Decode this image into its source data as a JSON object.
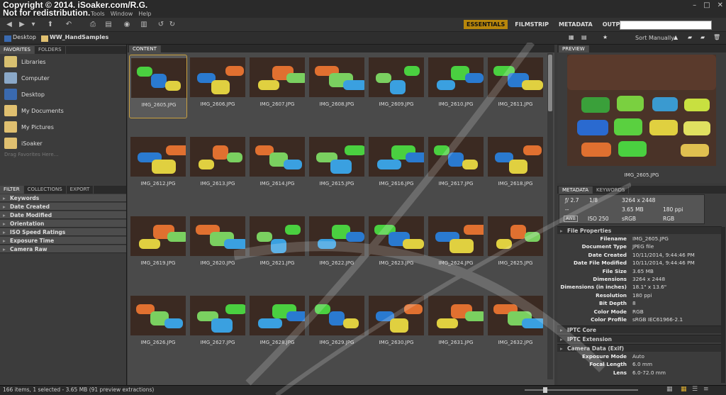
{
  "watermark": {
    "line1": "Copyright © 2014. iSoaker.com/R.G.",
    "line2": "Not for redistribution."
  },
  "menu": [
    "Tools",
    "Window",
    "Help"
  ],
  "window_controls": [
    "–",
    "□",
    "✕"
  ],
  "workspaces": [
    {
      "label": "ESSENTIALS",
      "active": true
    },
    {
      "label": "FILMSTRIP",
      "active": false
    },
    {
      "label": "METADATA",
      "active": false
    },
    {
      "label": "OUTPUT",
      "active": false
    }
  ],
  "search": {
    "value": "",
    "placeholder": ""
  },
  "path": {
    "root": "Desktop",
    "folder": "WW_HandSamples"
  },
  "sort": {
    "label": "Sort Manually"
  },
  "left_tabs": {
    "favorites": "FAVORITES",
    "folders": "FOLDERS"
  },
  "favorites": [
    {
      "label": "Libraries",
      "icon": "libraries-icon",
      "color": "#d8c070"
    },
    {
      "label": "Computer",
      "icon": "computer-icon",
      "color": "#8aa8c8"
    },
    {
      "label": "Desktop",
      "icon": "desktop-icon",
      "color": "#3a6ab0"
    },
    {
      "label": "My Documents",
      "icon": "folder-icon",
      "color": "#e0c070"
    },
    {
      "label": "My Pictures",
      "icon": "folder-icon",
      "color": "#e0c070"
    },
    {
      "label": "iSoaker",
      "icon": "folder-icon",
      "color": "#e0c070"
    }
  ],
  "drag_hint": "Drag Favorites Here...",
  "filter_tabs": {
    "filter": "FILTER",
    "collections": "COLLECTIONS",
    "export": "EXPORT"
  },
  "filters": [
    "Keywords",
    "Date Created",
    "Date Modified",
    "Orientation",
    "ISO Speed Ratings",
    "Exposure Time",
    "Camera Raw"
  ],
  "content_tab": "CONTENT",
  "thumbnails": [
    "IMG_2605.JPG",
    "IMG_2606.JPG",
    "IMG_2607.JPG",
    "IMG_2608.JPG",
    "IMG_2609.JPG",
    "IMG_2610.JPG",
    "IMG_2611.JPG",
    "IMG_2612.JPG",
    "IMG_2613.JPG",
    "IMG_2614.JPG",
    "IMG_2615.JPG",
    "IMG_2616.JPG",
    "IMG_2617.JPG",
    "IMG_2618.JPG",
    "IMG_2619.JPG",
    "IMG_2620.JPG",
    "IMG_2621.JPG",
    "IMG_2622.JPG",
    "IMG_2623.JPG",
    "IMG_2624.JPG",
    "IMG_2625.JPG",
    "IMG_2626.JPG",
    "IMG_2627.JPG",
    "IMG_2628.JPG",
    "IMG_2629.JPG",
    "IMG_2630.JPG",
    "IMG_2631.JPG",
    "IMG_2632.JPG"
  ],
  "selected_index": 0,
  "preview": {
    "tab": "PREVIEW",
    "caption": "IMG_2605.JPG"
  },
  "meta_tabs": {
    "metadata": "METADATA",
    "keywords": "KEYWORDS"
  },
  "exif": {
    "aperture": "ƒ/ 2.7",
    "shutter": "1/8",
    "dimensions": "3264 x 2448",
    "size": "3.65 MB",
    "ppi": "180 ppi",
    "wb": "AWB",
    "iso": "ISO 250",
    "color": "sRGB",
    "mode": "RGB",
    "dash": "--"
  },
  "sections": {
    "file_properties": "File Properties",
    "iptc_core": "IPTC Core",
    "iptc_ext": "IPTC Extension",
    "camera": "Camera Data (Exif)"
  },
  "file_properties": [
    {
      "k": "Filename",
      "v": "IMG_2605.JPG"
    },
    {
      "k": "Document Type",
      "v": "JPEG file"
    },
    {
      "k": "Date Created",
      "v": "10/11/2014, 9:44:46 PM"
    },
    {
      "k": "Date File Modified",
      "v": "10/11/2014, 9:44:46 PM"
    },
    {
      "k": "File Size",
      "v": "3.65 MB"
    },
    {
      "k": "Dimensions",
      "v": "3264 x 2448"
    },
    {
      "k": "Dimensions (in inches)",
      "v": "18.1\" x 13.6\""
    },
    {
      "k": "Resolution",
      "v": "180 ppi"
    },
    {
      "k": "Bit Depth",
      "v": "8"
    },
    {
      "k": "Color Mode",
      "v": "RGB"
    },
    {
      "k": "Color Profile",
      "v": "sRGB IEC61966-2.1"
    }
  ],
  "camera": [
    {
      "k": "Exposure Mode",
      "v": "Auto"
    },
    {
      "k": "Focal Length",
      "v": "6.0 mm"
    },
    {
      "k": "Lens",
      "v": "6.0-72.0 mm"
    }
  ],
  "status": "166 items, 1 selected - 3.65 MB (91 preview extractions)",
  "zoom_level": 0.16
}
